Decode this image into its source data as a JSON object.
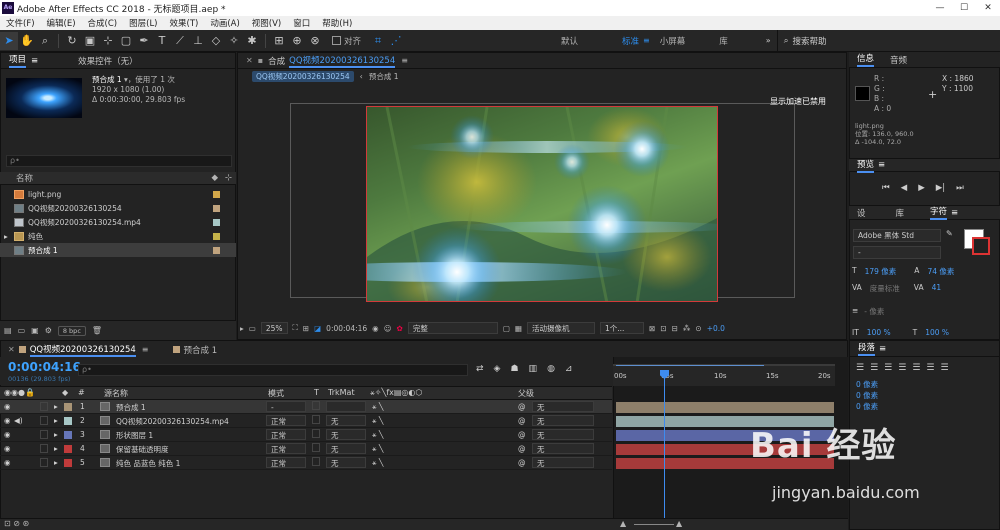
{
  "window": {
    "title": "Adobe After Effects CC 2018 - 无标题项目.aep *",
    "logo": "Ae",
    "min": "—",
    "max": "☐",
    "close": "✕"
  },
  "menu": [
    "文件(F)",
    "编辑(E)",
    "合成(C)",
    "图层(L)",
    "效果(T)",
    "动画(A)",
    "视图(V)",
    "窗口",
    "帮助(H)"
  ],
  "toolbar": {
    "align_label": "对齐",
    "workspaces": [
      "默认",
      "标准",
      "小屏幕",
      "库"
    ],
    "active_workspace": "标准",
    "search_label": "搜索帮助"
  },
  "project": {
    "tab_project": "项目",
    "tab_effects": "效果控件（无）",
    "selected_name": "预合成 1",
    "selected_usage": "，使用了 1 次",
    "selected_dims": "1920 x 1080 (1.00)",
    "selected_duration": "Δ 0:00:30:00, 29.803 fps",
    "search_placeholder": "ρ•",
    "col_name": "名称",
    "items": [
      {
        "name": "light.png",
        "type": "png",
        "label_color": "#d3a84a"
      },
      {
        "name": "QQ视频20200326130254",
        "type": "comp",
        "label_color": "#c0a37e"
      },
      {
        "name": "QQ视频20200326130254.mp4",
        "type": "mp4",
        "label_color": "#a7c7c6"
      },
      {
        "name": "纯色",
        "type": "folder",
        "label_color": "#c5b34a"
      },
      {
        "name": "预合成 1",
        "type": "comp",
        "label_color": "#c0a37e"
      }
    ],
    "bpc": "8 bpc"
  },
  "comp": {
    "tab_label": "合成",
    "tab_name": "QQ视频20200326130254",
    "breadcrumb": [
      "QQ视频20200326130254",
      "预合成 1"
    ],
    "gpu_label": "显示加速已禁用",
    "zoom": "25%",
    "time": "0:00:04:16",
    "quality": "完整",
    "camera": "活动摄像机",
    "views": "1个...",
    "exposure": "+0.0"
  },
  "info": {
    "tab_info": "信息",
    "tab_audio": "音频",
    "r": "R :",
    "g": "G :",
    "b": "B :",
    "a": "A : 0",
    "x": "X : 1860",
    "y": "Y : 1100",
    "file": "light.png",
    "pos": "位置: 136.0, 960.0",
    "delta": "Δ -104.0, 72.0"
  },
  "preview": {
    "tab": "预览"
  },
  "character": {
    "tab_left": "设",
    "tab_lib": "库",
    "tab_char": "字符",
    "font": "Adobe 黑体 Std",
    "style": "-",
    "size": "179 像素",
    "leading": "74 像素",
    "kerning": "度量标准",
    "tracking": "41",
    "stroke": "- 像素",
    "scale_v": "100 %",
    "scale_h": "100 %"
  },
  "paragraph": {
    "tab": "段落",
    "vals": [
      "0 像素",
      "0 像素",
      "0 像素",
      "0 像素",
      "0 像素"
    ]
  },
  "timeline": {
    "tab1": "QQ视频20200326130254",
    "tab2": "预合成 1",
    "timecode": "0:00:04:16",
    "frames": "00136 (29.803 fps)",
    "col_source": "源名称",
    "col_mode": "模式",
    "col_t": "T",
    "col_trkmat": "TrkMat",
    "col_parent": "父级",
    "ruler": [
      "00s",
      "05s",
      "10s",
      "15s",
      "20s"
    ],
    "layers": [
      {
        "num": "1",
        "name": "预合成 1",
        "mode": "-",
        "trk": "",
        "parent": "无",
        "color": "#a89476",
        "track": "#8e7f6a"
      },
      {
        "num": "2",
        "name": "QQ视频20200326130254.mp4",
        "mode": "正常",
        "trk": "无",
        "parent": "无",
        "color": "#a7c7c6",
        "track": "#8fa5a4"
      },
      {
        "num": "3",
        "name": "形状图层 1",
        "mode": "正常",
        "trk": "无",
        "parent": "无",
        "color": "#6676b8",
        "track": "#5a66a5"
      },
      {
        "num": "4",
        "name": "保留基础透明度",
        "mode": "正常",
        "trk": "无",
        "parent": "无",
        "color": "#c03b3b",
        "track": "#a63a3a"
      },
      {
        "num": "5",
        "name": "纯色 品蓝色 纯色 1",
        "mode": "正常",
        "trk": "无",
        "parent": "无",
        "color": "#c03b3b",
        "track": "#a63a3a"
      }
    ]
  },
  "watermark": {
    "brand": "Bai 经验",
    "url": "jingyan.baidu.com"
  }
}
